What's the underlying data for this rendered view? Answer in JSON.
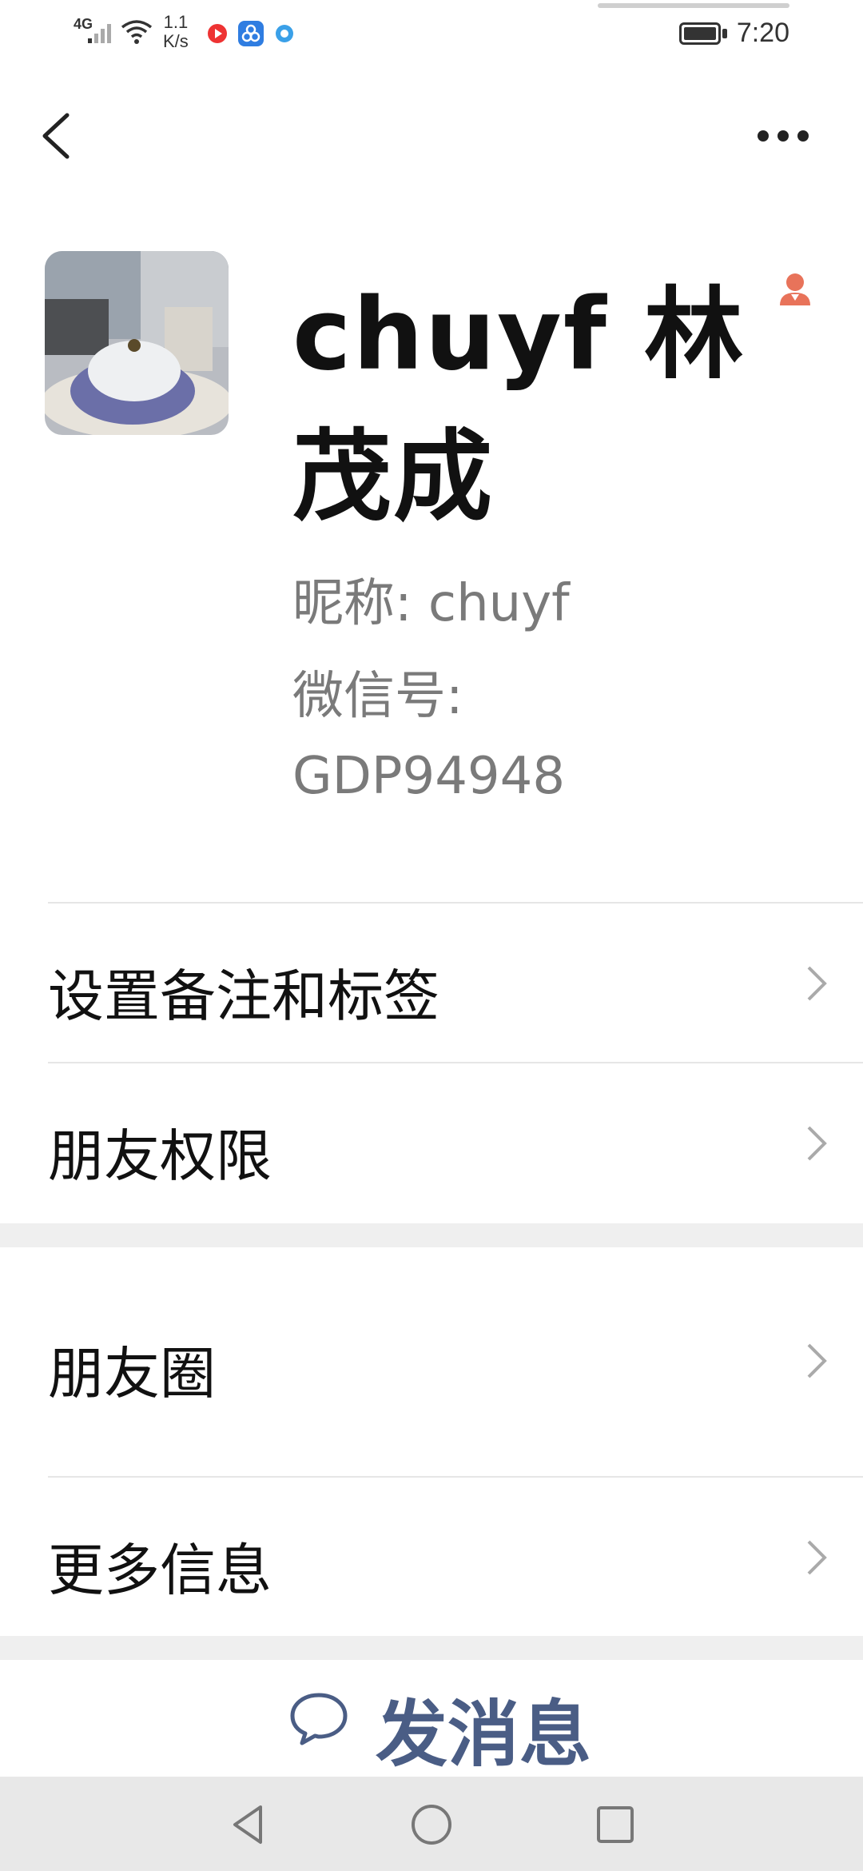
{
  "status_bar": {
    "network": "4G",
    "speed_value": "1.1",
    "speed_unit": "K/s",
    "time": "7:20"
  },
  "profile": {
    "display_name": "chuyf 林茂成",
    "nickname": "昵称:  chuyf",
    "wechat_id_label": "微信号:",
    "wechat_id": "GDP94948"
  },
  "menu": {
    "items": [
      {
        "label": "设置备注和标签"
      },
      {
        "label": "朋友权限"
      },
      {
        "label": "朋友圈"
      },
      {
        "label": "更多信息"
      }
    ]
  },
  "actions": {
    "send_message": "发消息"
  },
  "colors": {
    "accent_link": "#4a5d85",
    "gender_icon": "#e8735a",
    "secondary_text": "#7a7a7a",
    "section_gap": "#efefef"
  },
  "icons": {
    "back": "chevron-left-icon",
    "more": "more-dots-icon",
    "gender": "female-icon",
    "chevron": "chevron-right-icon",
    "send": "chat-bubble-icon",
    "nav_back": "triangle-back-icon",
    "nav_home": "circle-home-icon",
    "nav_recent": "square-recent-icon"
  }
}
